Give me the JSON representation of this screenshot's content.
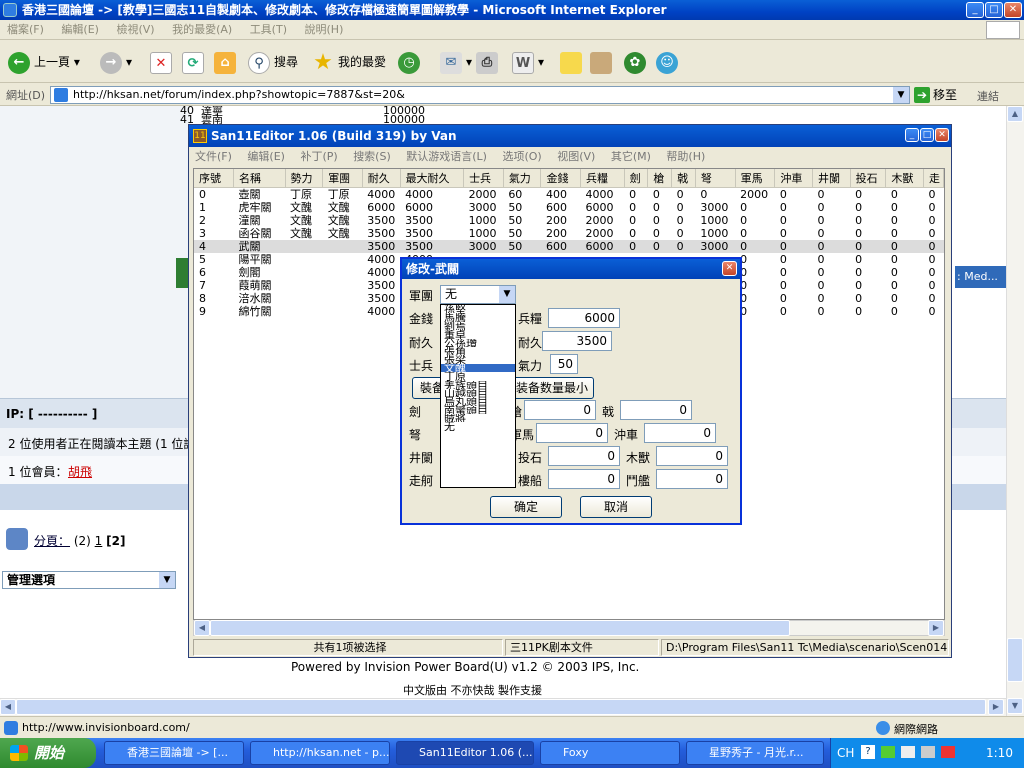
{
  "ie": {
    "title": "香港三國論壇 -> [教學]三國志11自製劇本、修改劇本、修改存檔極速簡單圖解教學 - Microsoft Internet Explorer",
    "menu": [
      "檔案(F)",
      "編輯(E)",
      "檢視(V)",
      "我的最愛(A)",
      "工具(T)",
      "說明(H)"
    ],
    "toolbar": {
      "back": "上一頁",
      "search": "搜尋",
      "favorites": "我的最愛"
    },
    "address_label": "網址(D)",
    "address": "http://hksan.net/forum/index.php?showtopic=7887&st=20&",
    "go": "移至",
    "links": "連結",
    "status_url": "http://www.invisionboard.com/",
    "status_zone": "網際網路"
  },
  "forum": {
    "ip_label": "IP: [ ---------- ]",
    "readers": "2 位使用者正在閱讀本主題 (1 位訪",
    "members_label": "1 位會員：",
    "member_name": "胡飛",
    "pages_label": "分頁：",
    "pages_total": "(2)",
    "page1": "1",
    "page2": "[2]",
    "admin_select": "管理選項",
    "powered": "Powered by Invision Power Board(U) v1.2 © 2003  IPS, Inc.",
    "chinese": "中文版由 不亦快哉 製作支援",
    "bg_rows": [
      [
        "40",
        "達寧",
        "100000"
      ],
      [
        "41",
        "雲南",
        "100000"
      ]
    ],
    "side_text": ": Med..."
  },
  "editor": {
    "title": "San11Editor 1.06 (Build 319) by Van",
    "menu": [
      "文件(F)",
      "编辑(E)",
      "补丁(P)",
      "搜索(S)",
      "默认游戏语言(L)",
      "选项(O)",
      "视图(V)",
      "其它(M)",
      "帮助(H)"
    ],
    "columns": [
      "序號",
      "名稱",
      "勢力",
      "軍團",
      "耐久",
      "最大耐久",
      "士兵",
      "氣力",
      "金錢",
      "兵糧",
      "劍",
      "槍",
      "戟",
      "弩",
      "軍馬",
      "沖車",
      "井闌",
      "投石",
      "木獸",
      "走"
    ],
    "rows": [
      [
        "0",
        "壺關",
        "丁原",
        "丁原",
        "4000",
        "4000",
        "2000",
        "60",
        "400",
        "4000",
        "0",
        "0",
        "0",
        "0",
        "2000",
        "0",
        "0",
        "0",
        "0",
        "0"
      ],
      [
        "1",
        "虎牢關",
        "文醜",
        "文醜",
        "6000",
        "6000",
        "3000",
        "50",
        "600",
        "6000",
        "0",
        "0",
        "0",
        "3000",
        "0",
        "0",
        "0",
        "0",
        "0",
        "0"
      ],
      [
        "2",
        "潼關",
        "文醜",
        "文醜",
        "3500",
        "3500",
        "1000",
        "50",
        "200",
        "2000",
        "0",
        "0",
        "0",
        "1000",
        "0",
        "0",
        "0",
        "0",
        "0",
        "0"
      ],
      [
        "3",
        "函谷關",
        "文醜",
        "文醜",
        "3500",
        "3500",
        "1000",
        "50",
        "200",
        "2000",
        "0",
        "0",
        "0",
        "1000",
        "0",
        "0",
        "0",
        "0",
        "0",
        "0"
      ],
      [
        "4",
        "武關",
        "",
        "",
        "3500",
        "3500",
        "3000",
        "50",
        "600",
        "6000",
        "0",
        "0",
        "0",
        "3000",
        "0",
        "0",
        "0",
        "0",
        "0",
        "0"
      ],
      [
        "5",
        "陽平關",
        "",
        "",
        "4000",
        "4000",
        "",
        "",
        "",
        "",
        "",
        "",
        "",
        "",
        "0",
        "0",
        "0",
        "0",
        "0",
        "0"
      ],
      [
        "6",
        "劍閣",
        "",
        "",
        "4000",
        "",
        "",
        "",
        "",
        "",
        "",
        "",
        "",
        "",
        "0",
        "0",
        "0",
        "0",
        "0",
        "0"
      ],
      [
        "7",
        "葭萌關",
        "",
        "",
        "3500",
        "",
        "",
        "",
        "",
        "",
        "",
        "",
        "",
        "",
        "0",
        "0",
        "0",
        "0",
        "0",
        "0"
      ],
      [
        "8",
        "涪水關",
        "",
        "",
        "3500",
        "",
        "",
        "",
        "",
        "",
        "",
        "",
        "",
        "",
        "0",
        "0",
        "0",
        "0",
        "0",
        "0"
      ],
      [
        "9",
        "綿竹關",
        "",
        "",
        "4000",
        "",
        "",
        "",
        "",
        "",
        "",
        "",
        "",
        "",
        "0",
        "0",
        "0",
        "0",
        "0",
        "0"
      ]
    ],
    "status": [
      "共有1项被选择",
      "三11PK剧本文件",
      "D:\\Program Files\\San11 Tc\\Media\\scenario\\Scen014.s11"
    ]
  },
  "dialog": {
    "title": "修改-武關",
    "army_label": "軍團",
    "army_value": "无",
    "options": [
      "孫堅",
      "馬騰",
      "劉焉",
      "董卓",
      "公孫瓚",
      "張角",
      "張梁",
      "文醜",
      "丁原",
      "羌族頭目",
      "山越頭目",
      "烏丸頭目",
      "南蠻頭目",
      "賊將",
      "无"
    ],
    "highlighted": "文醜",
    "gold_label": "金錢",
    "food_label": "兵糧",
    "food_value": "6000",
    "dur_label": "耐久",
    "maxdur_label": "耐久",
    "maxdur_value": "3500",
    "soldier_label": "士兵",
    "morale_label": "氣力",
    "morale_value": "50",
    "equip_btn": "裝备",
    "equip_min_btn": "装备数量最小",
    "sword_label": "劍",
    "spear_label": "槍",
    "spear_value": "0",
    "halberd_label": "戟",
    "halberd_value": "0",
    "bow_label": "弩",
    "horse_label": "軍馬",
    "horse_value": "0",
    "ram_label": "沖車",
    "ram_value": "0",
    "tower_label": "井闌",
    "catapult_label": "投石",
    "catapult_value": "0",
    "beast_label": "木獸",
    "beast_value": "0",
    "boat_label": "走舸",
    "ship_label": "樓船",
    "ship_value": "0",
    "warship_label": "鬥艦",
    "warship_value": "0",
    "ok": "确定",
    "cancel": "取消"
  },
  "taskbar": {
    "start": "開始",
    "tasks": [
      "香港三國論壇 -> [...",
      "http://hksan.net - p...",
      "San11Editor 1.06 (...",
      "Foxy",
      "星野秀子 - 月光.r..."
    ],
    "lang": "CH",
    "time": "1:10"
  }
}
